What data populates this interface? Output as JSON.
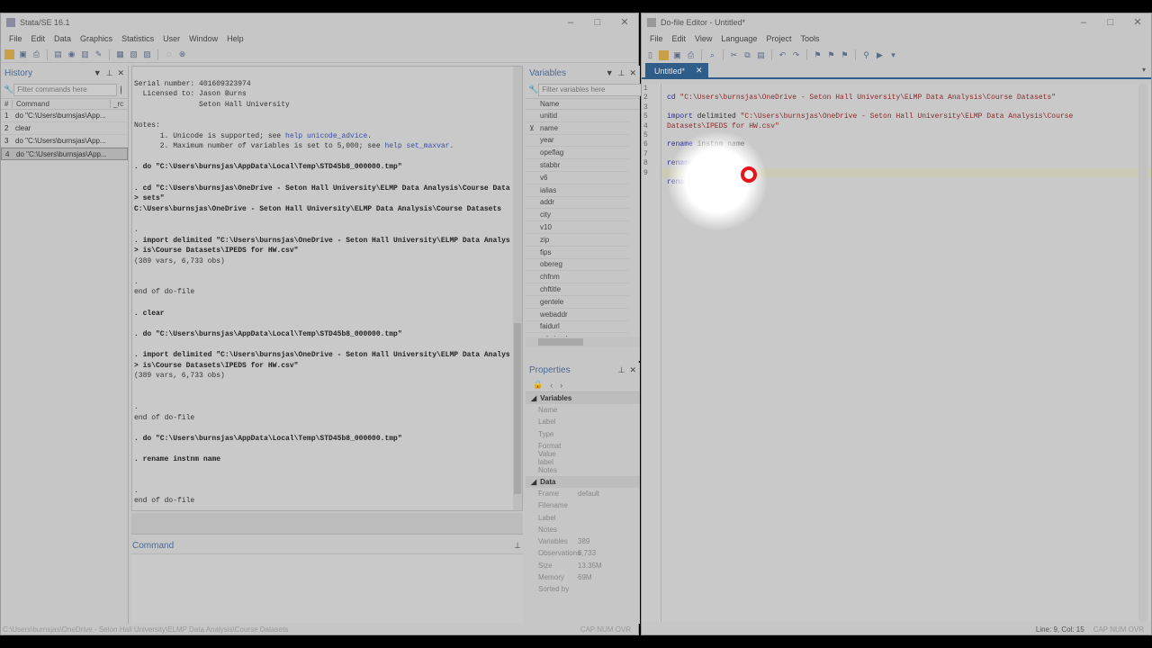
{
  "stata": {
    "title": "Stata/SE 16.1",
    "menu": [
      "File",
      "Edit",
      "Data",
      "Graphics",
      "Statistics",
      "User",
      "Window",
      "Help"
    ],
    "history": {
      "title": "History",
      "filter_placeholder": "Filter commands here",
      "col_num": "#",
      "col_command": "Command",
      "col_rc": "_rc",
      "rows": [
        {
          "num": "1",
          "cmd": "do \"C:\\Users\\burnsjas\\App..."
        },
        {
          "num": "2",
          "cmd": "clear"
        },
        {
          "num": "3",
          "cmd": "do \"C:\\Users\\burnsjas\\App..."
        },
        {
          "num": "4",
          "cmd": "do \"C:\\Users\\burnsjas\\App..."
        }
      ]
    },
    "results": {
      "l1": "Serial number: 401609323974",
      "l2": "  Licensed to: Jason Burns",
      "l3": "               Seton Hall University",
      "l4": "Notes:",
      "l5a": "      1. Unicode is supported; see ",
      "l5b": "help unicode_advice",
      "l5c": ".",
      "l6a": "      2. Maximum number of variables is set to 5,000; see ",
      "l6b": "help set_maxvar",
      "l6c": ".",
      "c1": ". do \"C:\\Users\\burnsjas\\AppData\\Local\\Temp\\STD45b8_000000.tmp\"",
      "c2": ". cd \"C:\\Users\\burnsjas\\OneDrive - Seton Hall University\\ELMP Data Analysis\\Course Data",
      "c2b": "> sets\"",
      "o2": "C:\\Users\\burnsjas\\OneDrive - Seton Hall University\\ELMP Data Analysis\\Course Datasets",
      "dot": ".",
      "c3": ". import delimited \"C:\\Users\\burnsjas\\OneDrive - Seton Hall University\\ELMP Data Analys",
      "c3b": "> is\\Course Datasets\\IPEDS for HW.csv\"",
      "o3": "(389 vars, 6,733 obs)",
      "eod": "end of do-file",
      "c4": ". clear",
      "c6": ". rename instnm name"
    },
    "command_title": "Command",
    "variables": {
      "title": "Variables",
      "filter_placeholder": "Filter variables here",
      "col_name": "Name",
      "items": [
        "unitid",
        "name",
        "year",
        "opeflag",
        "stabbr",
        "v6",
        "ialias",
        "addr",
        "city",
        "v10",
        "zip",
        "fips",
        "obereg",
        "chfnm",
        "chftitle",
        "gentele",
        "webaddr",
        "faidurl",
        "admisurl"
      ]
    },
    "properties": {
      "title": "Properties",
      "sec_variables": "Variables",
      "var_rows": [
        {
          "k": "Name",
          "v": ""
        },
        {
          "k": "Label",
          "v": ""
        },
        {
          "k": "Type",
          "v": ""
        },
        {
          "k": "Format",
          "v": ""
        },
        {
          "k": "Value label",
          "v": ""
        },
        {
          "k": "Notes",
          "v": ""
        }
      ],
      "sec_data": "Data",
      "data_rows": [
        {
          "k": "Frame",
          "v": "default"
        },
        {
          "k": "Filename",
          "v": ""
        },
        {
          "k": "Label",
          "v": ""
        },
        {
          "k": "Notes",
          "v": ""
        },
        {
          "k": "Variables",
          "v": "389"
        },
        {
          "k": "Observations",
          "v": "6,733"
        },
        {
          "k": "Size",
          "v": "13.35M"
        },
        {
          "k": "Memory",
          "v": "69M"
        },
        {
          "k": "Sorted by",
          "v": ""
        }
      ]
    },
    "status_path": "C:\\Users\\burnsjas\\OneDrive - Seton Hall University\\ELMP Data Analysis\\Course Datasets",
    "status_flags": "CAP  NUM  OVR"
  },
  "editor": {
    "title": "Do-file Editor - Untitled*",
    "menu": [
      "File",
      "Edit",
      "View",
      "Language",
      "Project",
      "Tools"
    ],
    "tab": "Untitled*",
    "gutter": [
      "1",
      "2",
      "3",
      "5",
      "4",
      "5",
      "6",
      "7",
      "8",
      "9"
    ],
    "line1_kw": "cd",
    "line1_str": " \"C:\\Users\\burnsjas\\OneDrive - Seton Hall University\\ELMP Data Analysis\\Course Datasets\"",
    "line3_kw": "import",
    "line3_mid": " delimited ",
    "line3_str": "\"C:\\Users\\burnsjas\\OneDrive - Seton Hall University\\ELMP Data Analysis\\Course",
    "line3b_str": "Datasets\\IPEDS for HW.csv\"",
    "rename_kw": "rename",
    "rename_rest": " instnm name",
    "rename_part": " instnm ",
    "rename_sel": "name",
    "status_pos": "Line: 9, Col: 15",
    "status_flags": "CAP  NUM  OVR"
  }
}
